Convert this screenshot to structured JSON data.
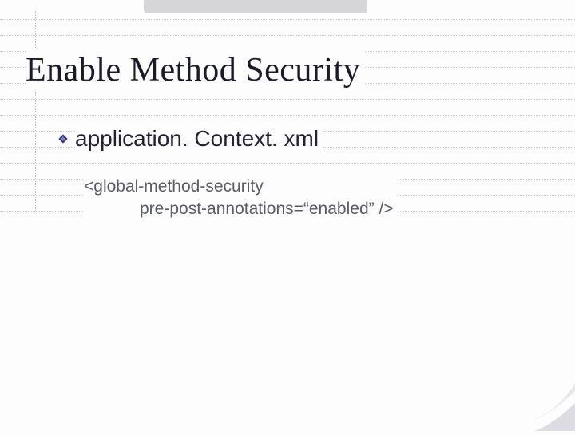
{
  "slide": {
    "title": "Enable Method Security",
    "bullet": {
      "label": "application. Context. xml"
    },
    "code": {
      "line1": "<global-method-security",
      "line2": "pre-post-annotations=“enabled” />"
    }
  }
}
